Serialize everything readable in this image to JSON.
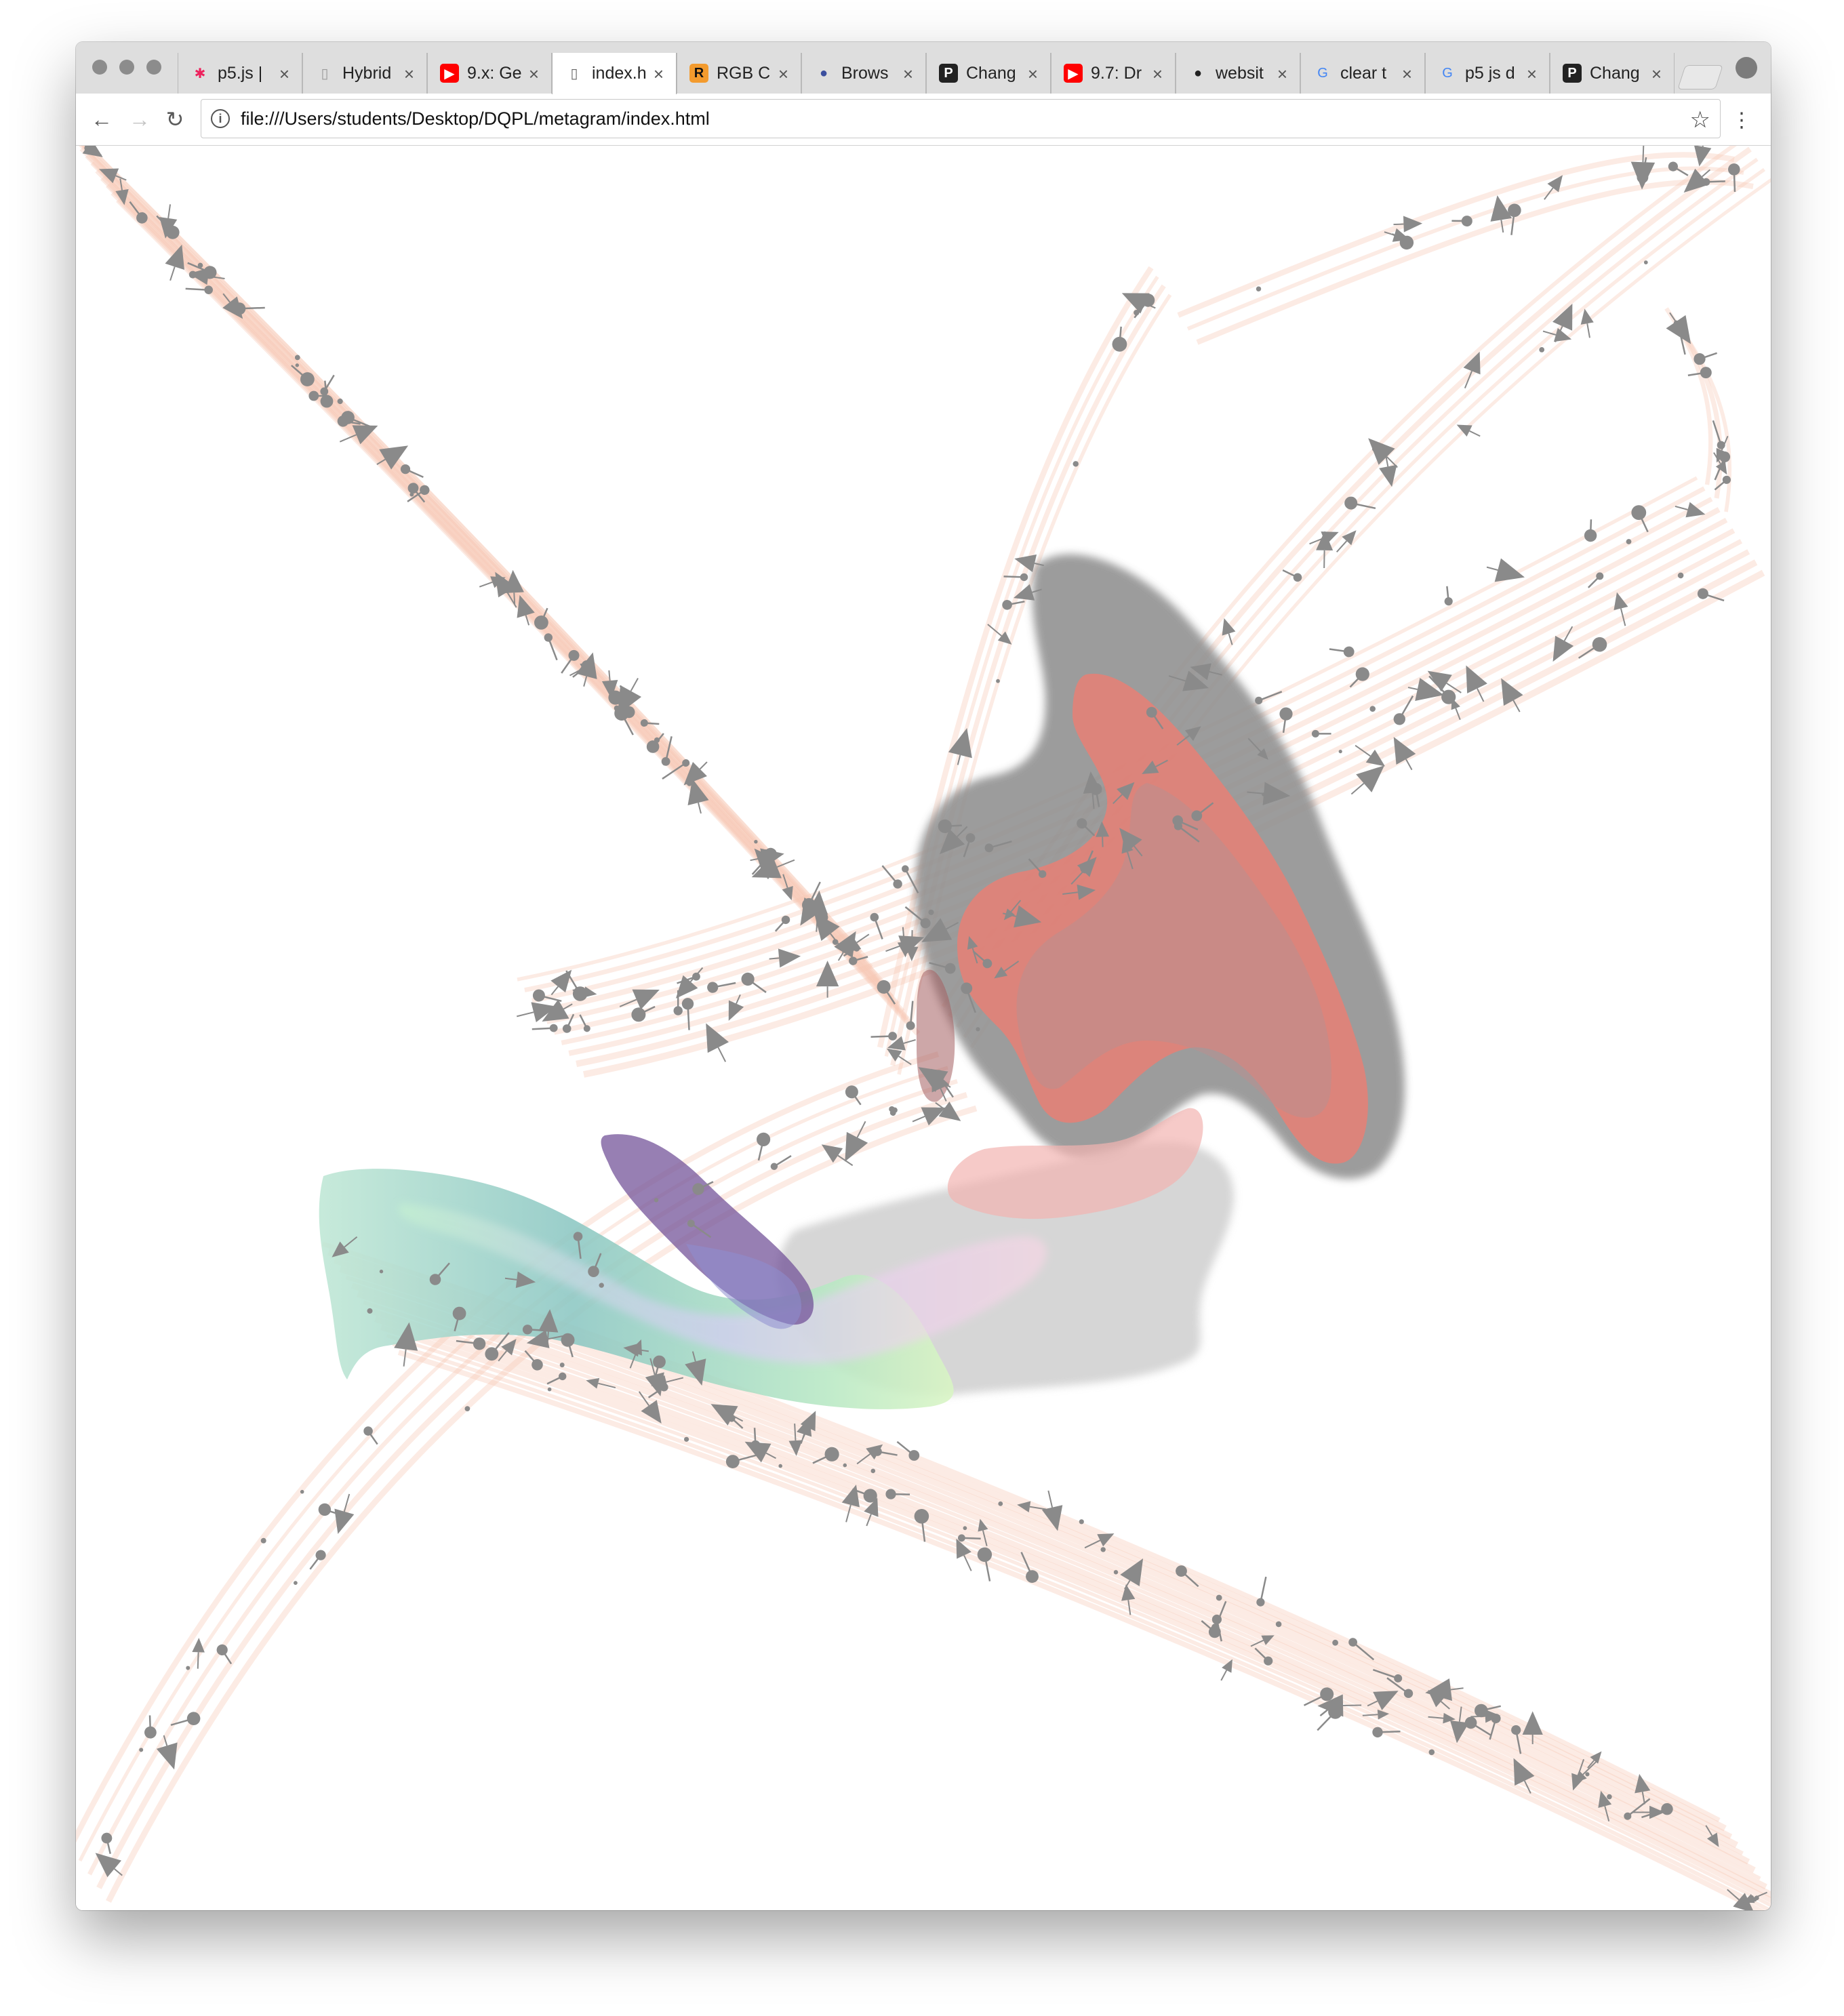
{
  "window": {
    "traffic_lights": [
      "close",
      "minimize",
      "zoom"
    ],
    "tabs": [
      {
        "title": "p5.js |",
        "icon": "p5-asterisk-icon",
        "active": false
      },
      {
        "title": "Hybrid",
        "icon": "document-shield-icon",
        "active": false
      },
      {
        "title": "9.x: Ge",
        "icon": "youtube-icon",
        "active": false
      },
      {
        "title": "index.h",
        "icon": "file-icon",
        "active": true
      },
      {
        "title": "RGB C",
        "icon": "r-logo-icon",
        "active": false
      },
      {
        "title": "Brows",
        "icon": "browser-globe-icon",
        "active": false
      },
      {
        "title": "Chang",
        "icon": "p-logo-icon",
        "active": false
      },
      {
        "title": "9.7: Dr",
        "icon": "youtube-icon",
        "active": false
      },
      {
        "title": "websit",
        "icon": "github-icon",
        "active": false
      },
      {
        "title": "clear t",
        "icon": "google-icon",
        "active": false
      },
      {
        "title": "p5 js d",
        "icon": "google-icon",
        "active": false
      },
      {
        "title": "Chang",
        "icon": "p-logo-icon",
        "active": false
      }
    ],
    "tab_close_glyph": "×"
  },
  "toolbar": {
    "back_glyph": "←",
    "forward_glyph": "→",
    "reload_glyph": "↻",
    "url": "file:///Users/students/Desktop/DQPL/metagram/index.html",
    "info_glyph": "i",
    "bookmark_glyph": "☆",
    "menu_glyph": "⋮"
  },
  "canvas": {
    "description_colors": {
      "marker": "#8a8a8a",
      "trail": "#f6c7b3",
      "blob_gray": "#9a9a9a",
      "blob_salmon": "#ee7d72",
      "ribbon_teal": "#8fc6c2",
      "ribbon_purple": "#7e5aa0"
    }
  }
}
